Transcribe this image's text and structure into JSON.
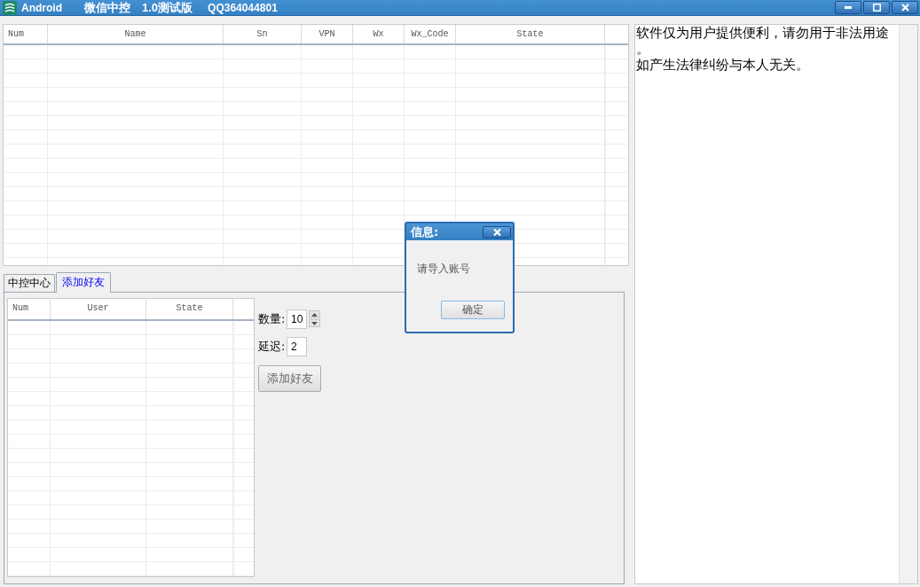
{
  "window": {
    "title_segments": [
      "Android",
      "微信中控",
      "1.0测试版",
      "QQ364044801"
    ]
  },
  "device_table": {
    "columns": [
      "Num",
      "Name",
      "Sn",
      "VPN",
      "Wx",
      "Wx_Code",
      "State"
    ]
  },
  "notice": {
    "lines": [
      "软件仅为用户提供便利，请勿用于非法用途。",
      "如产生法律纠纷与本人无关。"
    ]
  },
  "tabs": [
    {
      "label": "中控中心",
      "selected": false
    },
    {
      "label": "添加好友",
      "selected": true
    }
  ],
  "add_friend": {
    "table": {
      "columns": [
        "Num",
        "User",
        "State"
      ]
    },
    "fields": [
      {
        "kind": "spinner",
        "label": "数量:",
        "value": "10"
      },
      {
        "kind": "text",
        "label": "延迟:",
        "value": "2"
      }
    ],
    "button": "添加好友"
  },
  "dialog": {
    "title": "信息:",
    "message": "请导入账号",
    "button": "确定"
  }
}
